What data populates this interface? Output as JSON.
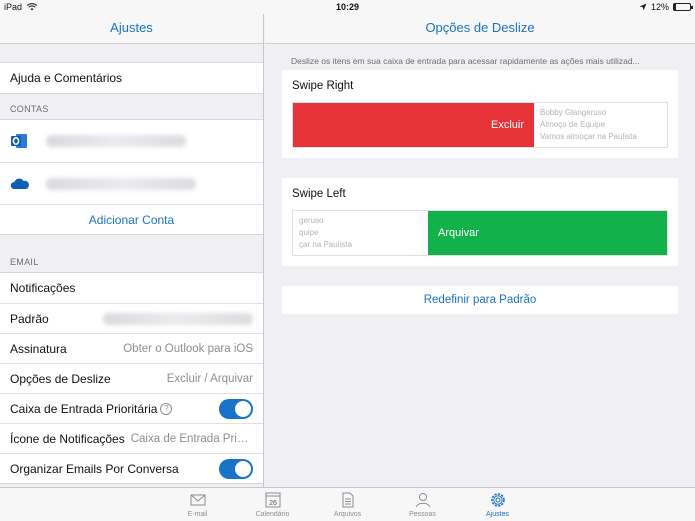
{
  "status": {
    "device": "iPad",
    "time": "10:29",
    "battery": "12%",
    "battery_level": 0.12
  },
  "left": {
    "title": "Ajustes",
    "help_label": "Ajuda e Comentários",
    "accounts_header": "CONTAS",
    "add_account_label": "Adicionar Conta",
    "email_header": "EMAIL",
    "rows": [
      {
        "label": "Notificações",
        "value": ""
      },
      {
        "label": "Padrão",
        "value": ""
      },
      {
        "label": "Assinatura",
        "value": "Obter o Outlook para iOS"
      },
      {
        "label": "Opções de Deslize",
        "value": "Excluir / Arquivar"
      },
      {
        "label": "Caixa de Entrada Prioritária",
        "value": ""
      },
      {
        "label": "Ícone de Notificações",
        "value": "Caixa de Entrada Priorit..."
      },
      {
        "label": "Organizar Emails Por Conversa",
        "value": ""
      }
    ],
    "icons": {
      "outlook": "outlook-icon",
      "onedrive": "onedrive-icon"
    },
    "toggles": {
      "focused_inbox": true,
      "organize_by_thread": true
    }
  },
  "right": {
    "title": "Opções de Deslize",
    "description": "Deslize os itens em sua caixa de entrada para acessar rapidamente as ações mais utilizad...",
    "swipe_right": {
      "title": "Swipe Right",
      "action": "Excluir",
      "preview": [
        "Bobby Glangeruso",
        "Almoço de Equipe",
        "Vamos almoçar na Paulista"
      ]
    },
    "swipe_left": {
      "title": "Swipe Left",
      "action": "Arquivar",
      "preview": [
        "geruso",
        "quipe",
        "çar na Paulista"
      ]
    },
    "reset_label": "Redefinir para Padrão"
  },
  "tabs": [
    {
      "label": "E-mail",
      "icon": "mail-icon"
    },
    {
      "label": "Calendário",
      "icon": "calendar-icon",
      "day": "26"
    },
    {
      "label": "Arquivos",
      "icon": "files-icon"
    },
    {
      "label": "Pessoas",
      "icon": "people-icon"
    },
    {
      "label": "Ajustes",
      "icon": "settings-icon",
      "active": true
    }
  ],
  "colors": {
    "accent": "#1a73c9",
    "delete": "#e8323a",
    "archive": "#12b14a"
  }
}
